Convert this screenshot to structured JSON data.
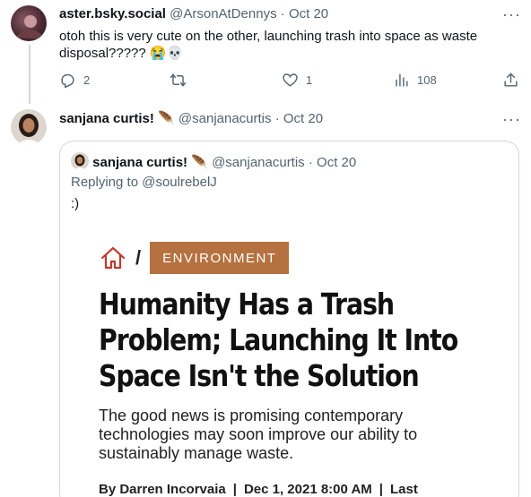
{
  "tweet1": {
    "display_name": "aster.bsky.social",
    "handle": "@ArsonAtDennys",
    "dot": "·",
    "date": "Oct 20",
    "text": "otoh this is very cute on the other, launching trash into space as waste disposal?????",
    "emoji": "😭💀",
    "more": "···",
    "replies": "2",
    "retweets": "",
    "likes": "1",
    "views": "108"
  },
  "tweet2": {
    "display_name": "sanjana curtis!",
    "badge_emoji": "🪶",
    "handle": "@sanjanacurtis",
    "dot": "·",
    "date": "Oct 20",
    "more": "···"
  },
  "quote": {
    "display_name": "sanjana curtis!",
    "badge_emoji": "🪶",
    "handle": "@sanjanacurtis",
    "dot": "·",
    "date": "Oct 20",
    "replying_to": "Replying to @soulrebelJ",
    "text": ":)",
    "article": {
      "slash": "/",
      "category": "ENVIRONMENT",
      "headline": "Humanity Has a Trash Problem; Launching It Into Space Isn't the Solution",
      "dek": "The good news is promising contemporary technologies may soon improve our ability to sustainably manage waste.",
      "author": "By Darren Incorvaia",
      "bar1": "|",
      "date": "Dec 1, 2021 8:00 AM",
      "bar2": "|",
      "last": "Last"
    }
  },
  "colors": {
    "category_bg": "#b5713f",
    "home_icon": "#c0392b",
    "muted": "#536471",
    "border": "#cfd9de"
  }
}
